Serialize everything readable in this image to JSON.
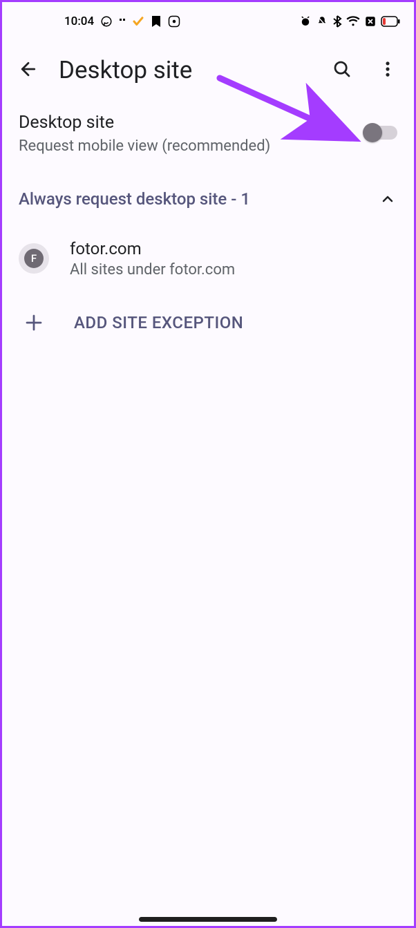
{
  "statusbar": {
    "time": "10:04"
  },
  "header": {
    "title": "Desktop site"
  },
  "setting": {
    "title": "Desktop site",
    "subtitle": "Request mobile view (recommended)",
    "enabled": false
  },
  "section": {
    "title": "Always request desktop site - 1",
    "expanded": true
  },
  "sites": [
    {
      "favicon_letter": "F",
      "name": "fotor.com",
      "sub": "All sites under fotor.com"
    }
  ],
  "add_exception": {
    "label": "ADD SITE EXCEPTION"
  },
  "annotation": {
    "arrow_color": "#a43cff"
  }
}
